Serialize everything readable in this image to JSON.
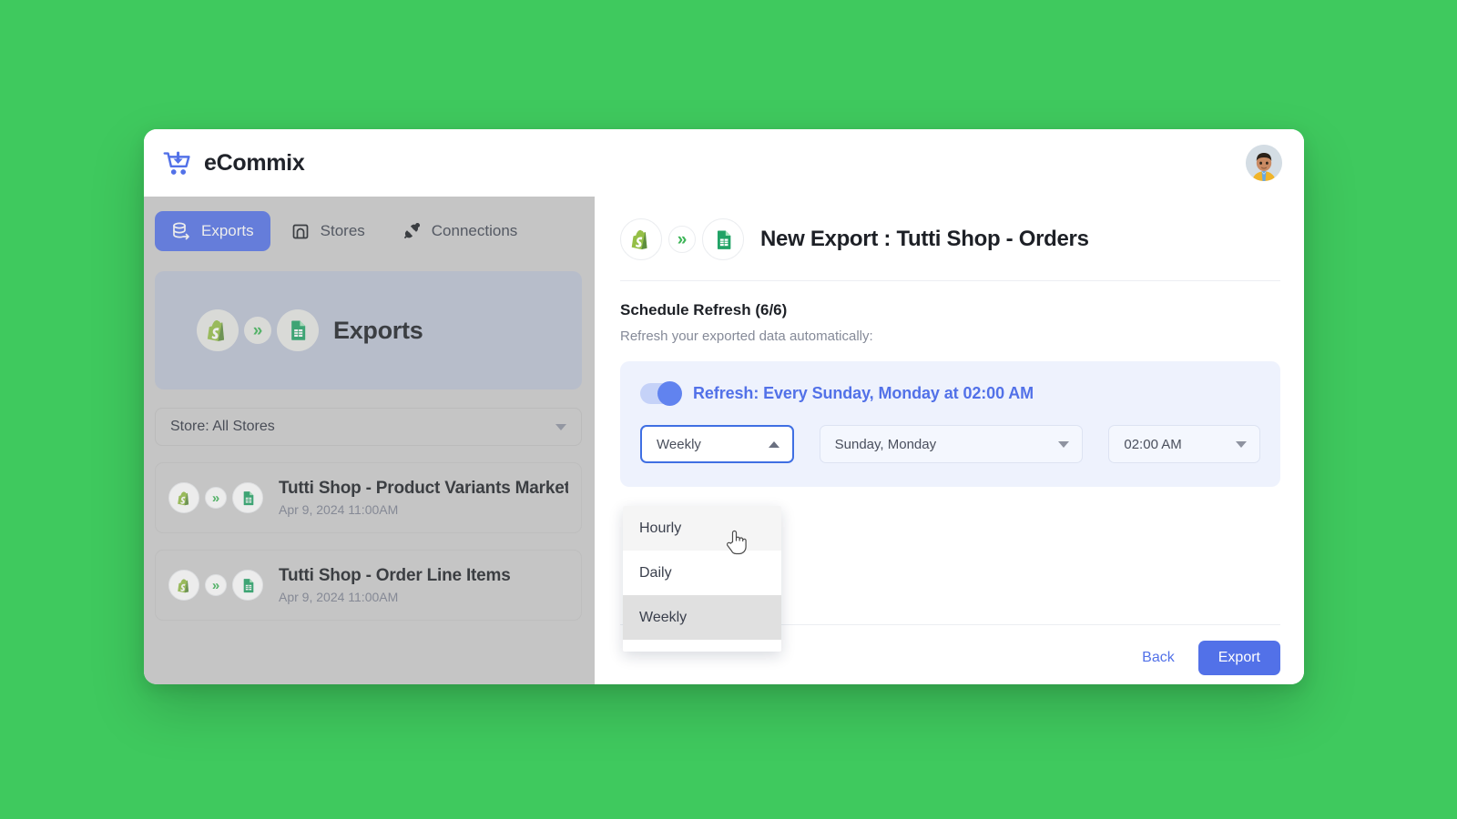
{
  "brand": {
    "name": "eCommix",
    "logo_icon": "shopping-cart-download-icon",
    "accent": "#5271e8"
  },
  "topbar": {
    "avatar_icon": "user-avatar"
  },
  "nav": {
    "tabs": [
      {
        "label": "Exports",
        "icon": "database-export-icon",
        "active": true
      },
      {
        "label": "Stores",
        "icon": "storefront-icon",
        "active": false
      },
      {
        "label": "Connections",
        "icon": "plug-connector-icon",
        "active": false
      }
    ]
  },
  "sidebar": {
    "card": {
      "title": "Exports",
      "source_icon": "shopify-icon",
      "arrow_icon": "double-chevron-right-icon",
      "target_icon": "google-sheets-icon"
    },
    "store_filter": {
      "label": "Store: All Stores",
      "caret_icon": "chevron-down-icon"
    },
    "exports": [
      {
        "name": "Tutti Shop - Product Variants Market",
        "date": "Apr 9, 2024 11:00AM"
      },
      {
        "name": "Tutti Shop - Order Line Items",
        "date": "Apr 9, 2024 11:00AM"
      }
    ]
  },
  "main": {
    "header": {
      "title": "New Export : Tutti Shop - Orders",
      "source_icon": "shopify-icon",
      "arrow_icon": "double-chevron-right-icon",
      "target_icon": "google-sheets-icon"
    },
    "step_title": "Schedule Refresh (6/6)",
    "step_subtitle": "Refresh your exported data automatically:",
    "refresh_panel": {
      "toggle_state": "on",
      "label": "Refresh: Every Sunday, Monday at 02:00 AM",
      "accent": "#5271e8",
      "background": "#eef2fd",
      "frequency_select": {
        "value": "Weekly",
        "caret_icon": "chevron-up-icon",
        "open": true
      },
      "days_select": {
        "value": "Sunday, Monday",
        "caret_icon": "chevron-down-icon"
      },
      "time_select": {
        "value": "02:00 AM",
        "caret_icon": "chevron-down-icon"
      }
    },
    "frequency_dropdown": {
      "options": [
        {
          "label": "Hourly",
          "state": "hover"
        },
        {
          "label": "Daily",
          "state": "normal"
        },
        {
          "label": "Weekly",
          "state": "selected"
        }
      ]
    },
    "footer": {
      "back_label": "Back",
      "export_label": "Export"
    }
  },
  "cursor": {
    "icon": "pointing-hand-cursor"
  }
}
